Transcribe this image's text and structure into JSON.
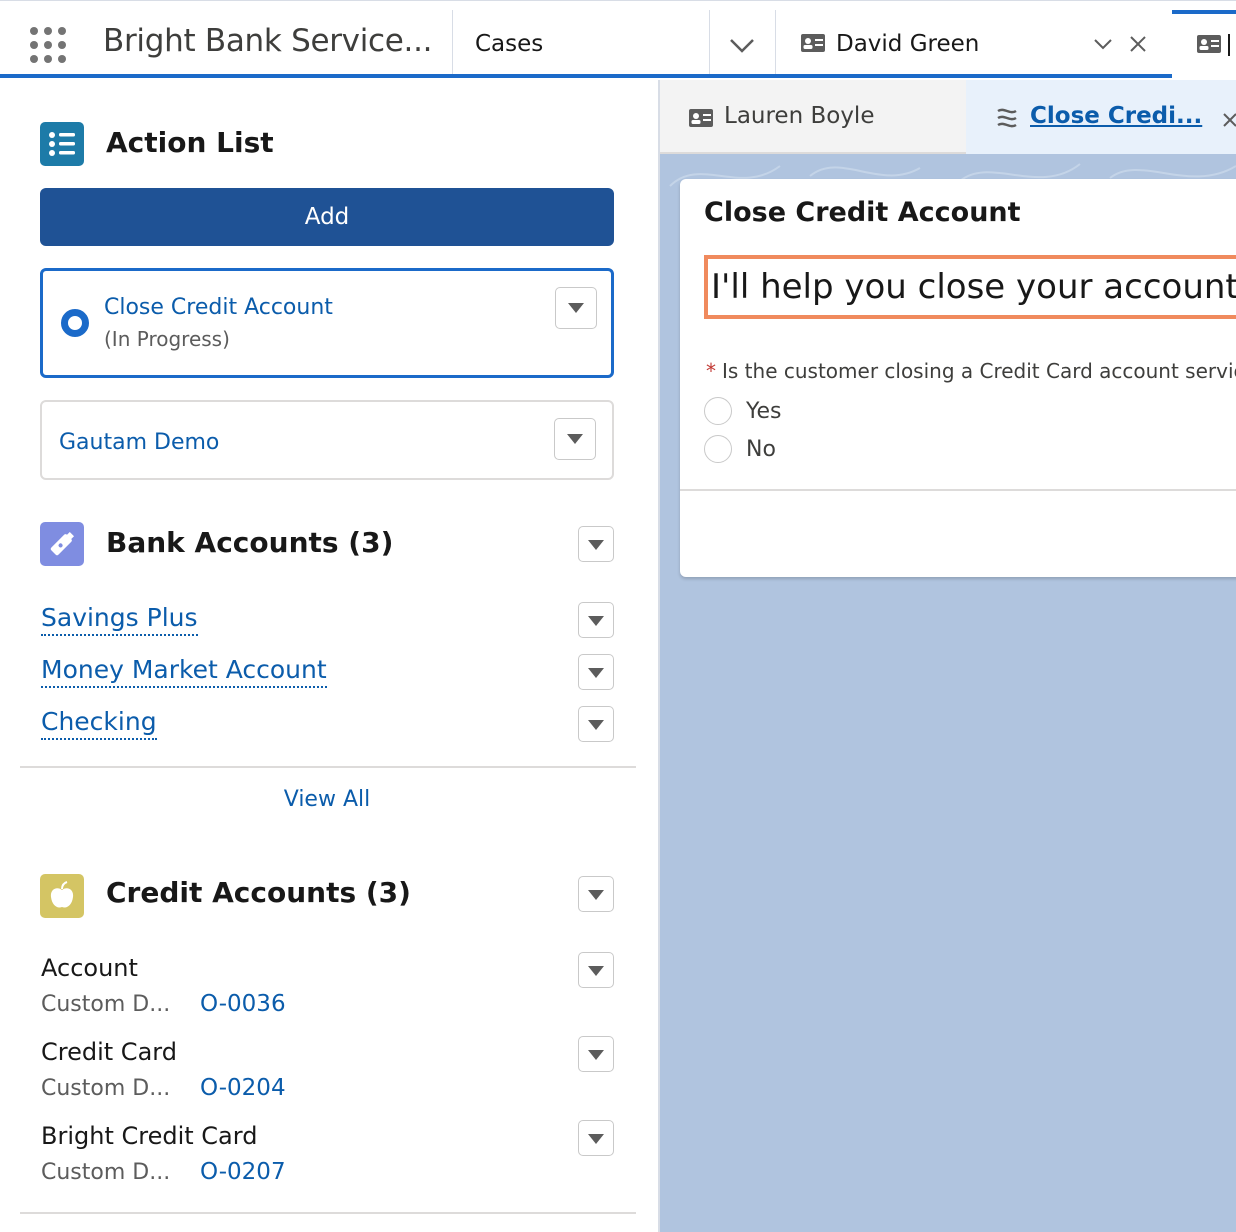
{
  "topbar": {
    "app_name": "Bright Bank Service...",
    "nav_item": "Cases",
    "tab_label": "David Green",
    "accent_color": "#1b6ac9",
    "icons": [
      "app-launcher-icon",
      "chevron-down-icon",
      "contact-card-icon",
      "close-icon"
    ]
  },
  "action_list": {
    "title": "Action List",
    "add_label": "Add",
    "items": [
      {
        "title": "Close Credit Account",
        "status": "(In Progress)"
      },
      {
        "title": "Gautam Demo"
      }
    ]
  },
  "bank_accounts": {
    "title": "Bank Accounts (3)",
    "items": [
      "Savings Plus",
      "Money Market Account",
      "Checking"
    ],
    "view_all": "View All"
  },
  "credit_accounts": {
    "title": "Credit Accounts (3)",
    "records": [
      {
        "name": "Account",
        "label": "Custom D...",
        "value": "O-0036"
      },
      {
        "name": "Credit Card",
        "label": "Custom D...",
        "value": "O-0204"
      },
      {
        "name": "Bright Credit Card",
        "label": "Custom D...",
        "value": "O-0207"
      }
    ]
  },
  "subtabs": {
    "contact_tab": "Lauren Boyle",
    "flow_tab": "Close Credi..."
  },
  "flow": {
    "title": "Close Credit Account",
    "message": "I'll help you close your account. I",
    "required_mark": "*",
    "question": "Is the customer closing a Credit Card account servic",
    "options": [
      "Yes",
      "No"
    ]
  }
}
